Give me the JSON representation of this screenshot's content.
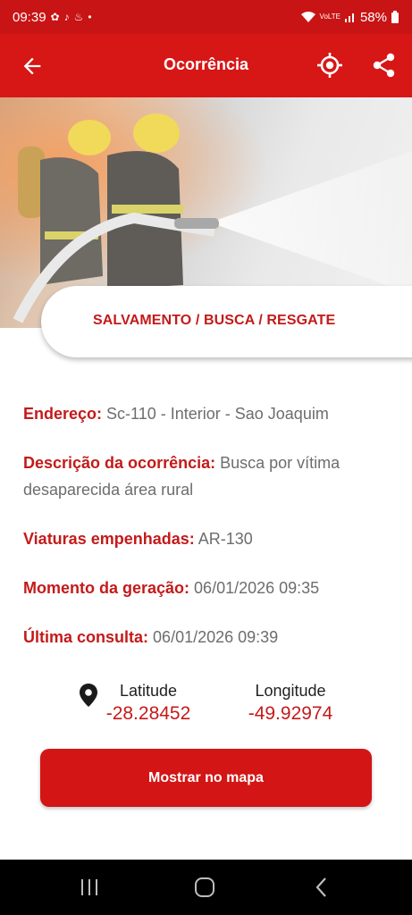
{
  "status_bar": {
    "time": "09:39",
    "notification_icons": [
      "fan-icon",
      "tiktok-icon",
      "flame-icon",
      "dot-icon"
    ],
    "network_label": "VoLTE",
    "battery": "58%"
  },
  "app_bar": {
    "title": "Ocorrência",
    "icons": [
      "back-arrow-icon",
      "locate-icon",
      "share-icon"
    ]
  },
  "occurrence": {
    "category": "SALVAMENTO / BUSCA / RESGATE",
    "fields": [
      {
        "label": "Endereço:",
        "value": "Sc-110 - Interior - Sao Joaquim"
      },
      {
        "label": "Descrição da ocorrência:",
        "value": "Busca por vítima desaparecida área rural"
      },
      {
        "label": "Viaturas empenhadas:",
        "value": "AR-130"
      },
      {
        "label": "Momento da geração:",
        "value": "06/01/2026 09:35"
      },
      {
        "label": "Última consulta:",
        "value": "06/01/2026 09:39"
      }
    ]
  },
  "coordinates": {
    "latitude_label": "Latitude",
    "latitude_value": "-28.28452",
    "longitude_label": "Longitude",
    "longitude_value": "-49.92974"
  },
  "map_button_label": "Mostrar no mapa",
  "colors": {
    "primary_red": "#d71616",
    "label_red": "#c41a1a",
    "value_gray": "#6d6d6d"
  }
}
